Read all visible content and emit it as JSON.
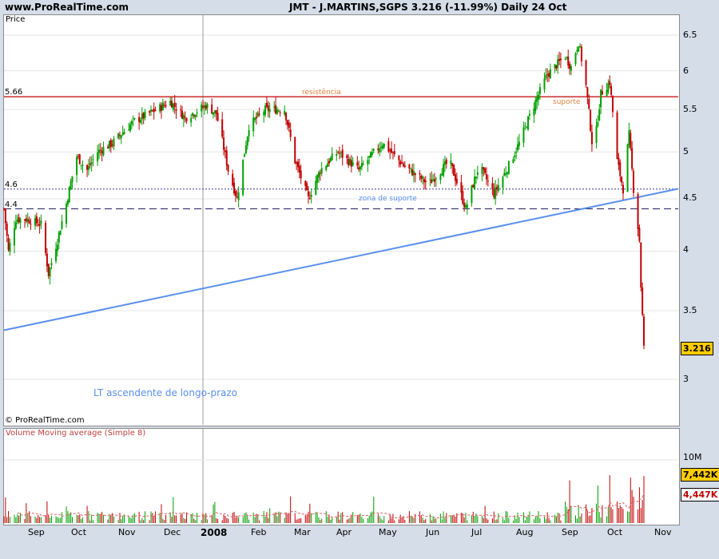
{
  "header": {
    "site": "www.ProRealTime.com",
    "title": "JMT - J.MARTINS,SGPS   3.216 (-11.99%)   Daily  24 Oct"
  },
  "price_panel": {
    "label": "Price",
    "credit": "© ProRealTime.com",
    "level_resist_value": "5.66",
    "level_46_value": "4.6",
    "level_44_value": "4.4",
    "annot_resistencia": "resistência",
    "annot_suporte": "suporte",
    "annot_zona": "zona de suporte",
    "annot_lt": "LT ascendente de longo-prazo",
    "last_price": "3.216",
    "y_ticks": [
      "6.5",
      "6",
      "5.5",
      "5",
      "4.5",
      "4",
      "3.5",
      "3"
    ]
  },
  "volume_panel": {
    "label": "Volume Moving average (Simple 8)",
    "y_tick": "10M",
    "badge_vol": "7,442K",
    "badge_ma": "4,447K"
  },
  "x_labels": [
    "Sep",
    "Oct",
    "Nov",
    "Dec",
    "2008",
    "Feb",
    "Mar",
    "Apr",
    "May",
    "Jun",
    "Jul",
    "Aug",
    "Sep",
    "Oct",
    "Nov"
  ],
  "colors": {
    "up": "#00a000",
    "down": "#c00000",
    "resist": "#c00000",
    "trend": "#5b8ff0",
    "dotted": "#3a3a8a",
    "dashed": "#202060",
    "vol_ma": "#e06060",
    "badge_yellow": "#ffcc00"
  },
  "chart_data": {
    "type": "candlestick",
    "title": "JMT - J.MARTINS,SGPS",
    "ylabel": "Price",
    "ylim": [
      2.7,
      6.7
    ],
    "y_scale": "log",
    "levels": [
      {
        "name": "resistência",
        "value": 5.66,
        "style": "solid"
      },
      {
        "name": "zona de suporte",
        "value": 4.6,
        "style": "dotted"
      },
      {
        "name": "zona de suporte",
        "value": 4.4,
        "style": "dashed"
      }
    ],
    "trendline": {
      "name": "LT ascendente de longo-prazo",
      "start": {
        "date": "2007-08-20",
        "price": 3.35
      },
      "end": {
        "date": "2008-10-31",
        "price": 4.57
      }
    },
    "close_path": [
      {
        "date": "2007-08-20",
        "close": 4.4
      },
      {
        "date": "2007-08-23",
        "close": 4.0
      },
      {
        "date": "2007-08-28",
        "close": 4.3
      },
      {
        "date": "2007-09-04",
        "close": 4.3
      },
      {
        "date": "2007-09-14",
        "close": 4.25
      },
      {
        "date": "2007-09-19",
        "close": 3.8
      },
      {
        "date": "2007-09-25",
        "close": 4.1
      },
      {
        "date": "2007-10-01",
        "close": 4.45
      },
      {
        "date": "2007-10-08",
        "close": 4.95
      },
      {
        "date": "2007-10-15",
        "close": 4.8
      },
      {
        "date": "2007-10-22",
        "close": 5.0
      },
      {
        "date": "2007-11-01",
        "close": 5.1
      },
      {
        "date": "2007-11-15",
        "close": 5.35
      },
      {
        "date": "2007-12-01",
        "close": 5.5
      },
      {
        "date": "2007-12-10",
        "close": 5.6
      },
      {
        "date": "2007-12-20",
        "close": 5.4
      },
      {
        "date": "2008-01-03",
        "close": 5.55
      },
      {
        "date": "2008-01-10",
        "close": 5.45
      },
      {
        "date": "2008-01-18",
        "close": 4.8
      },
      {
        "date": "2008-01-24",
        "close": 4.5
      },
      {
        "date": "2008-02-01",
        "close": 5.3
      },
      {
        "date": "2008-02-12",
        "close": 5.5
      },
      {
        "date": "2008-02-25",
        "close": 5.5
      },
      {
        "date": "2008-03-03",
        "close": 4.9
      },
      {
        "date": "2008-03-12",
        "close": 4.5
      },
      {
        "date": "2008-03-20",
        "close": 4.8
      },
      {
        "date": "2008-04-01",
        "close": 5.0
      },
      {
        "date": "2008-04-15",
        "close": 4.8
      },
      {
        "date": "2008-05-01",
        "close": 5.1
      },
      {
        "date": "2008-05-15",
        "close": 4.85
      },
      {
        "date": "2008-06-01",
        "close": 4.65
      },
      {
        "date": "2008-06-15",
        "close": 4.9
      },
      {
        "date": "2008-06-26",
        "close": 4.4
      },
      {
        "date": "2008-07-05",
        "close": 4.85
      },
      {
        "date": "2008-07-15",
        "close": 4.55
      },
      {
        "date": "2008-07-25",
        "close": 4.85
      },
      {
        "date": "2008-08-01",
        "close": 5.1
      },
      {
        "date": "2008-08-12",
        "close": 5.6
      },
      {
        "date": "2008-08-20",
        "close": 5.95
      },
      {
        "date": "2008-09-01",
        "close": 6.2
      },
      {
        "date": "2008-09-05",
        "close": 6.05
      },
      {
        "date": "2008-09-10",
        "close": 6.4
      },
      {
        "date": "2008-09-15",
        "close": 5.8
      },
      {
        "date": "2008-09-20",
        "close": 4.95
      },
      {
        "date": "2008-09-25",
        "close": 5.7
      },
      {
        "date": "2008-10-01",
        "close": 5.85
      },
      {
        "date": "2008-10-06",
        "close": 4.9
      },
      {
        "date": "2008-10-10",
        "close": 4.6
      },
      {
        "date": "2008-10-14",
        "close": 5.2
      },
      {
        "date": "2008-10-17",
        "close": 4.6
      },
      {
        "date": "2008-10-21",
        "close": 4.1
      },
      {
        "date": "2008-10-22",
        "close": 3.7
      },
      {
        "date": "2008-10-24",
        "close": 3.216
      }
    ],
    "volume_ma_period": 8,
    "volume_last": 7442000,
    "volume_ma_last": 4447000
  }
}
